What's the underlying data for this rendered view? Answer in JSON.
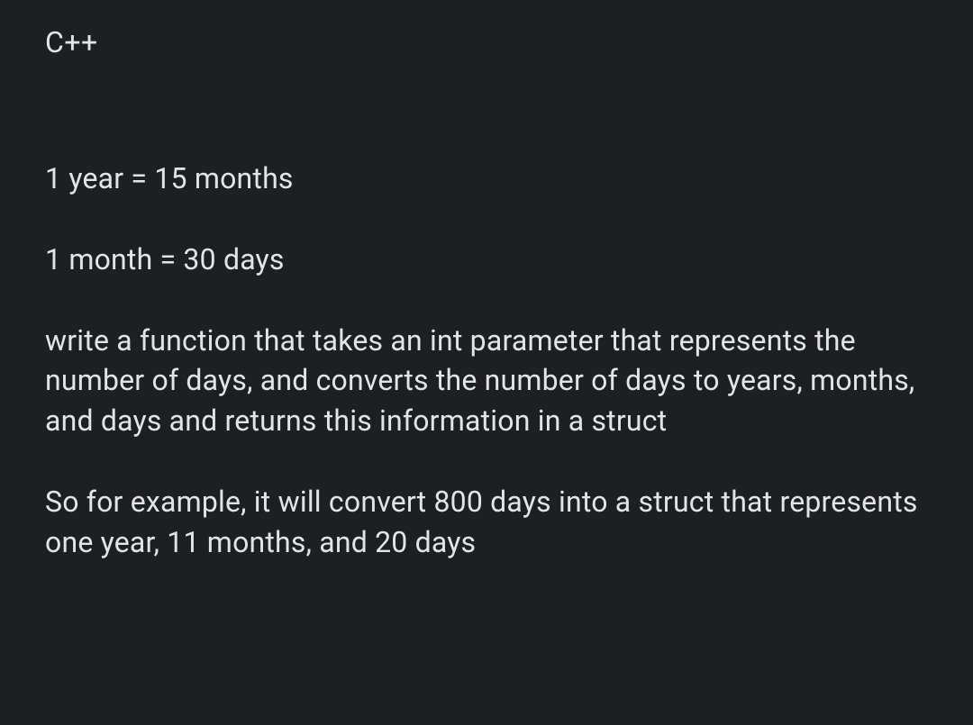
{
  "title": "C++",
  "paragraphs": [
    "1 year = 15 months",
    "1 month = 30 days",
    "write a function that takes an int parameter that represents the number of days, and converts the number of days to years, months, and days and returns this information in a struct",
    "So for example, it will convert 800 days into a struct that represents one year, 11 months, and 20 days"
  ]
}
